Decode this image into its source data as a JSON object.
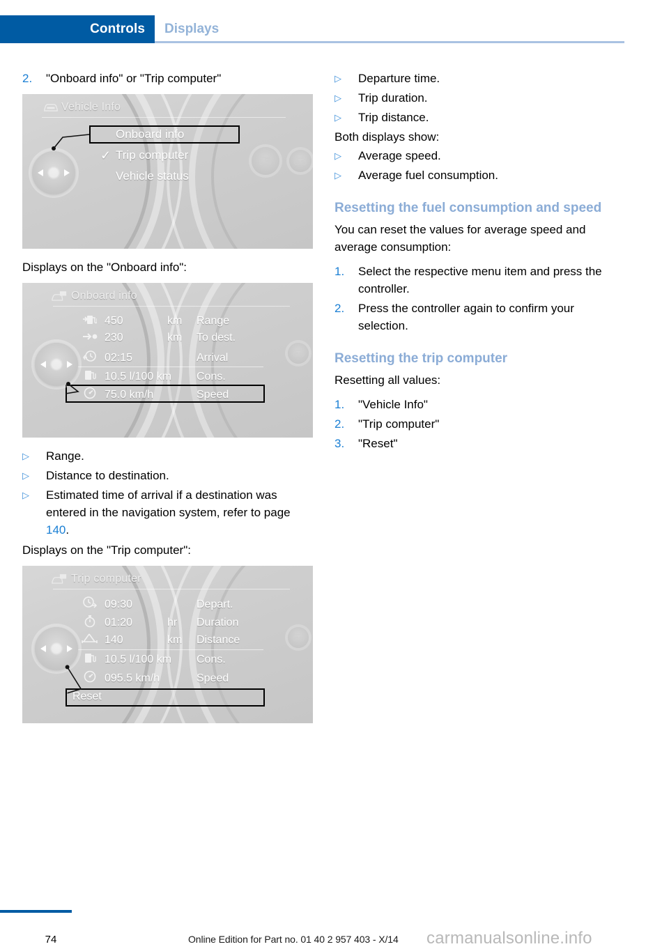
{
  "header": {
    "active_tab": "Controls",
    "inactive_tab": "Displays",
    "accent_color": "#005ba3",
    "rule_color": "#a9c2e2"
  },
  "left_column": {
    "step2": {
      "num": "2.",
      "text": "\"Onboard info\" or \"Trip computer\""
    },
    "caption_onboard": "Displays on the \"Onboard info\":",
    "bullets_onboard": [
      {
        "mark": "▷",
        "text": "Range."
      },
      {
        "mark": "▷",
        "text": "Distance to destination."
      },
      {
        "mark": "▷",
        "text": "Estimated time of arrival if a destination was entered in the navigation system, refer to page ",
        "pageref": "140",
        "tail": "."
      }
    ],
    "caption_trip": "Displays on the \"Trip computer\":"
  },
  "figure_vehicle_info": {
    "title": "Vehicle Info",
    "title_icon": "car-icon",
    "items": [
      {
        "label": "Onboard info",
        "selected": true,
        "checked": false
      },
      {
        "label": "Trip computer",
        "selected": false,
        "checked": true,
        "check": "✓"
      },
      {
        "label": "Vehicle status",
        "selected": false,
        "checked": false
      }
    ],
    "right_buttons": [
      "menu-icon",
      "display-icon"
    ],
    "controller_icon": "controller-knob"
  },
  "figure_onboard_info": {
    "title": "Onboard info",
    "title_icon": "display-car-icon",
    "rows": [
      {
        "icon": "fuel-pump-arrow-icon",
        "value": "450",
        "unit": "km",
        "label": "Range",
        "selected": false
      },
      {
        "icon": "arrow-destination-icon",
        "value": "230",
        "unit": "km",
        "label": "To dest.",
        "selected": false
      },
      {
        "icon": "clock-arrival-icon",
        "value": "02:15",
        "unit": "",
        "label": "Arrival",
        "selected": false
      },
      {
        "icon": "fuel-pump-icon",
        "value": "10.5 l/100 km",
        "unit": "",
        "label": "Cons.",
        "selected": false
      },
      {
        "icon": "speedometer-icon",
        "value": "75.0 km/h",
        "unit": "",
        "label": "Speed",
        "selected": true
      }
    ],
    "right_buttons": [
      "display-icon"
    ]
  },
  "figure_trip_computer": {
    "title": "Trip computer",
    "title_icon": "display-car-icon",
    "rows": [
      {
        "icon": "clock-depart-icon",
        "value": "09:30",
        "unit": "",
        "label": "Depart.",
        "selected": false
      },
      {
        "icon": "stopwatch-icon",
        "value": "01:20",
        "unit": "hr",
        "label": "Duration",
        "selected": false
      },
      {
        "icon": "distance-icon",
        "value": "140",
        "unit": "km",
        "label": "Distance",
        "selected": false
      },
      {
        "icon": "fuel-pump-icon",
        "value": "10.5 l/100 km",
        "unit": "",
        "label": "Cons.",
        "selected": false
      },
      {
        "icon": "speedometer-icon",
        "value": "095.5 km/h",
        "unit": "",
        "label": "Speed",
        "selected": false
      }
    ],
    "reset_button": "Reset",
    "right_buttons": [
      "display-icon"
    ]
  },
  "right_column": {
    "bullets_top": [
      {
        "mark": "▷",
        "text": "Departure time."
      },
      {
        "mark": "▷",
        "text": "Trip duration."
      },
      {
        "mark": "▷",
        "text": "Trip distance."
      }
    ],
    "both_displays_label": "Both displays show:",
    "bullets_both": [
      {
        "mark": "▷",
        "text": "Average speed."
      },
      {
        "mark": "▷",
        "text": "Average fuel consumption."
      }
    ],
    "section1": {
      "heading": "Resetting the fuel consumption and speed",
      "intro": "You can reset the values for average speed and average consumption:",
      "steps": [
        {
          "num": "1.",
          "text": "Select the respective menu item and press the controller."
        },
        {
          "num": "2.",
          "text": "Press the controller again to confirm your selection."
        }
      ]
    },
    "section2": {
      "heading": "Resetting the trip computer",
      "intro": "Resetting all values:",
      "steps": [
        {
          "num": "1.",
          "text": "\"Vehicle Info\""
        },
        {
          "num": "2.",
          "text": "\"Trip computer\""
        },
        {
          "num": "3.",
          "text": "\"Reset\""
        }
      ]
    }
  },
  "footer": {
    "page_number": "74",
    "edition_text": "Online Edition for Part no. 01 40 2 957 403 - X/14",
    "watermark": "carmanualsonline.info"
  }
}
